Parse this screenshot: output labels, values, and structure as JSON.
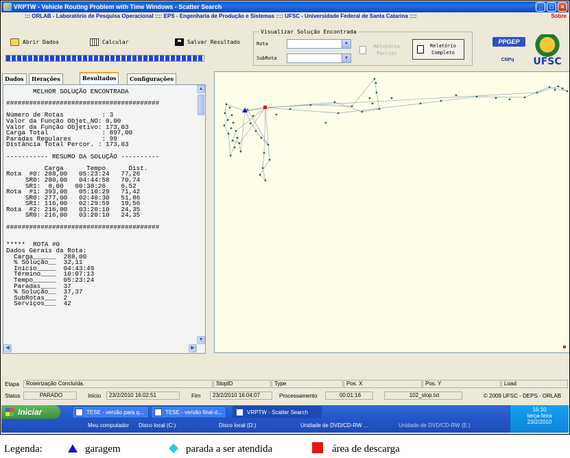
{
  "window": {
    "title": "VRPTW - Vehicle Routing Problem with Time Windows - Scatter Search",
    "buttons": [
      "_",
      "□",
      "×"
    ]
  },
  "banner": {
    "text": "::: ORLAB - Laboratório de Pesquisa Operacional :::: EPS - Engenharia de Produção e Sistemas :::: UFSC - Universidade Federal de Santa Catarina ::::",
    "right": "Sobre"
  },
  "toolbar": {
    "open_label": "Abrir Dados",
    "calc_label": "Calcular",
    "save_label": "Salvar Resultado",
    "progress": 1.0
  },
  "viz": {
    "title": "Visualizar Solução Encontrada",
    "route_label": "Rota",
    "subroute_label": "SubRota",
    "route_value": "",
    "subroute_value": "",
    "partial_report": "Relatório Parcial",
    "full_report": "Relatório Completo"
  },
  "logos": {
    "ppgep": "PPGEP",
    "cnpq": "CNPq",
    "ufsc": "UFSC"
  },
  "tabs": [
    "Dados",
    "Iterações",
    "Resultados",
    "Configurações"
  ],
  "active_tab": "Resultados",
  "results_text": "       MELHOR SOLUÇÃO ENCONTRADA\n\n########################################\n\nNúmero de Rotas          : 3\nValor da Função Objet_NO: 0,00\nValor da Função Objetivo: 173,03\nCarga Total              : 897,00\nParadas Regulares        : 99\nDistância Total Percor. : 173,03\n\n----------- RESUMO DA SOLUÇÃO ----------\n\n          Carga      Tempo      Dist.\nRota  #0: 288,00   05:23:24   77,26\n     SR0: 280,00   04:44:58   70,74\n     SR1:  8,00   00:38:26    6,52\nRota  #1: 393,00   05:10:29   71,42\n     SR0: 277,00   02:40:30   51,86\n     SR1: 116,00   02:29:59   19,56\nRota  #2: 216,00   03:20:10   24,35\n     SR0: 216,00   03:20:10   24,35\n\n########################################\n\n\n*****  ROTA #0\nDados Gerais da Rota:\n  Carga______  288,00\n  % Solução__  32,11\n  Início_____  04:43:49\n  Término____  10:07:13\n  Tempo______  05:23:24\n  Paradas____  37\n  % Solução__  37,37\n  SubRotas___  2\n  Serviços___  42",
  "status1": {
    "etapa_label": "Etapa",
    "etapa_value": "Roteirização Concluída.",
    "stopid_label": "StopID",
    "type_label": "Type",
    "posx_label": "Pos. X",
    "posy_label": "Pos. Y",
    "load_label": "Load"
  },
  "status2": {
    "status_label": "Status",
    "status_value": "PARADO",
    "inicio_label": "Início",
    "inicio_value": "23/2/2010 16:02:51",
    "fim_label": "Fim",
    "fim_value": "23/2/2010 16:04:07",
    "proc_label": "Processamento",
    "proc_value": "00:01:16",
    "file_value": "102_stop.txt",
    "copyright": "© 2009 UFSC - DEPS - ORLAB"
  },
  "taskbar": {
    "start": "Iniciar",
    "tasks": [
      "TESE - versão para q...",
      "TESE - versão final-d...",
      "VRPTW - Scatter Search"
    ],
    "quick": [
      "Meu computador",
      "Disco local (C:)",
      "Disco local (D:)",
      "Unidade de DVD/CD-RW ...",
      "Unidade de DVD/CD-RW (E:)"
    ],
    "time": "16:10",
    "weekday": "terça-feira",
    "date": "23/2/2010"
  },
  "legend": {
    "label": "Legenda:",
    "garage": "garagem",
    "stop": "parada a ser atendida",
    "unload": "área de descarga",
    "garage_color": "#1111cc",
    "stop_color": "#22ccee",
    "unload_color": "#ee1111"
  },
  "map_colors": {
    "background": "#fffee8",
    "route_line": "#9aa6b8",
    "node": "#1a6b5a"
  }
}
